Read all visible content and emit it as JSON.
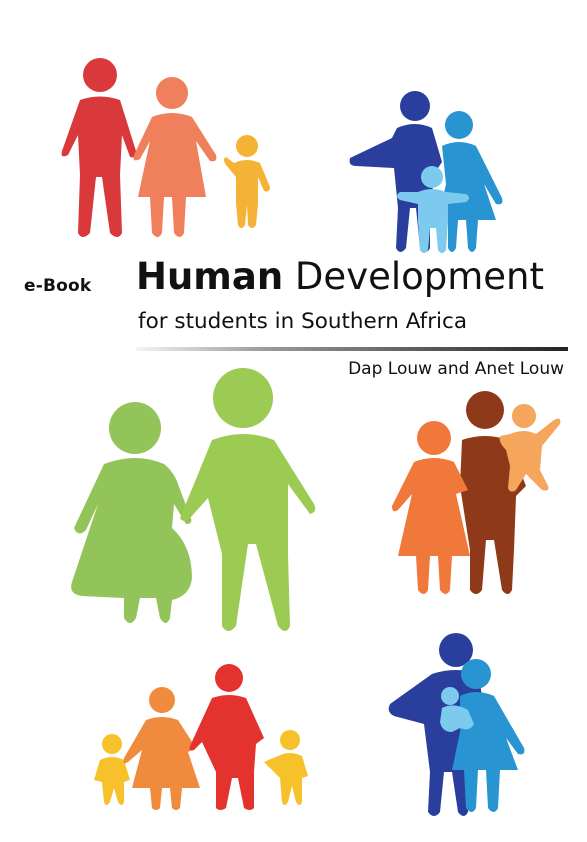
{
  "cover": {
    "ebook_label": "e-Book",
    "title_strong": "Human",
    "title_rest": " Development",
    "subtitle_prefix": "for students in ",
    "subtitle_region": "Southern Africa",
    "authors": "Dap Louw and Anet Louw"
  },
  "palette": {
    "red": "#d9393b",
    "salmon": "#f07f5c",
    "amber": "#f5b335",
    "navy": "#2a3f9d",
    "sky": "#2894d1",
    "light_blue": "#7ccbee",
    "green_light": "#93c45a",
    "green": "#9ccb54",
    "orange": "#f0783a",
    "brown": "#8e3a1a",
    "peach": "#f5a55c",
    "yellow": "#f6c12a",
    "orange_mid": "#f08a3c",
    "red_bright": "#e4322e"
  }
}
